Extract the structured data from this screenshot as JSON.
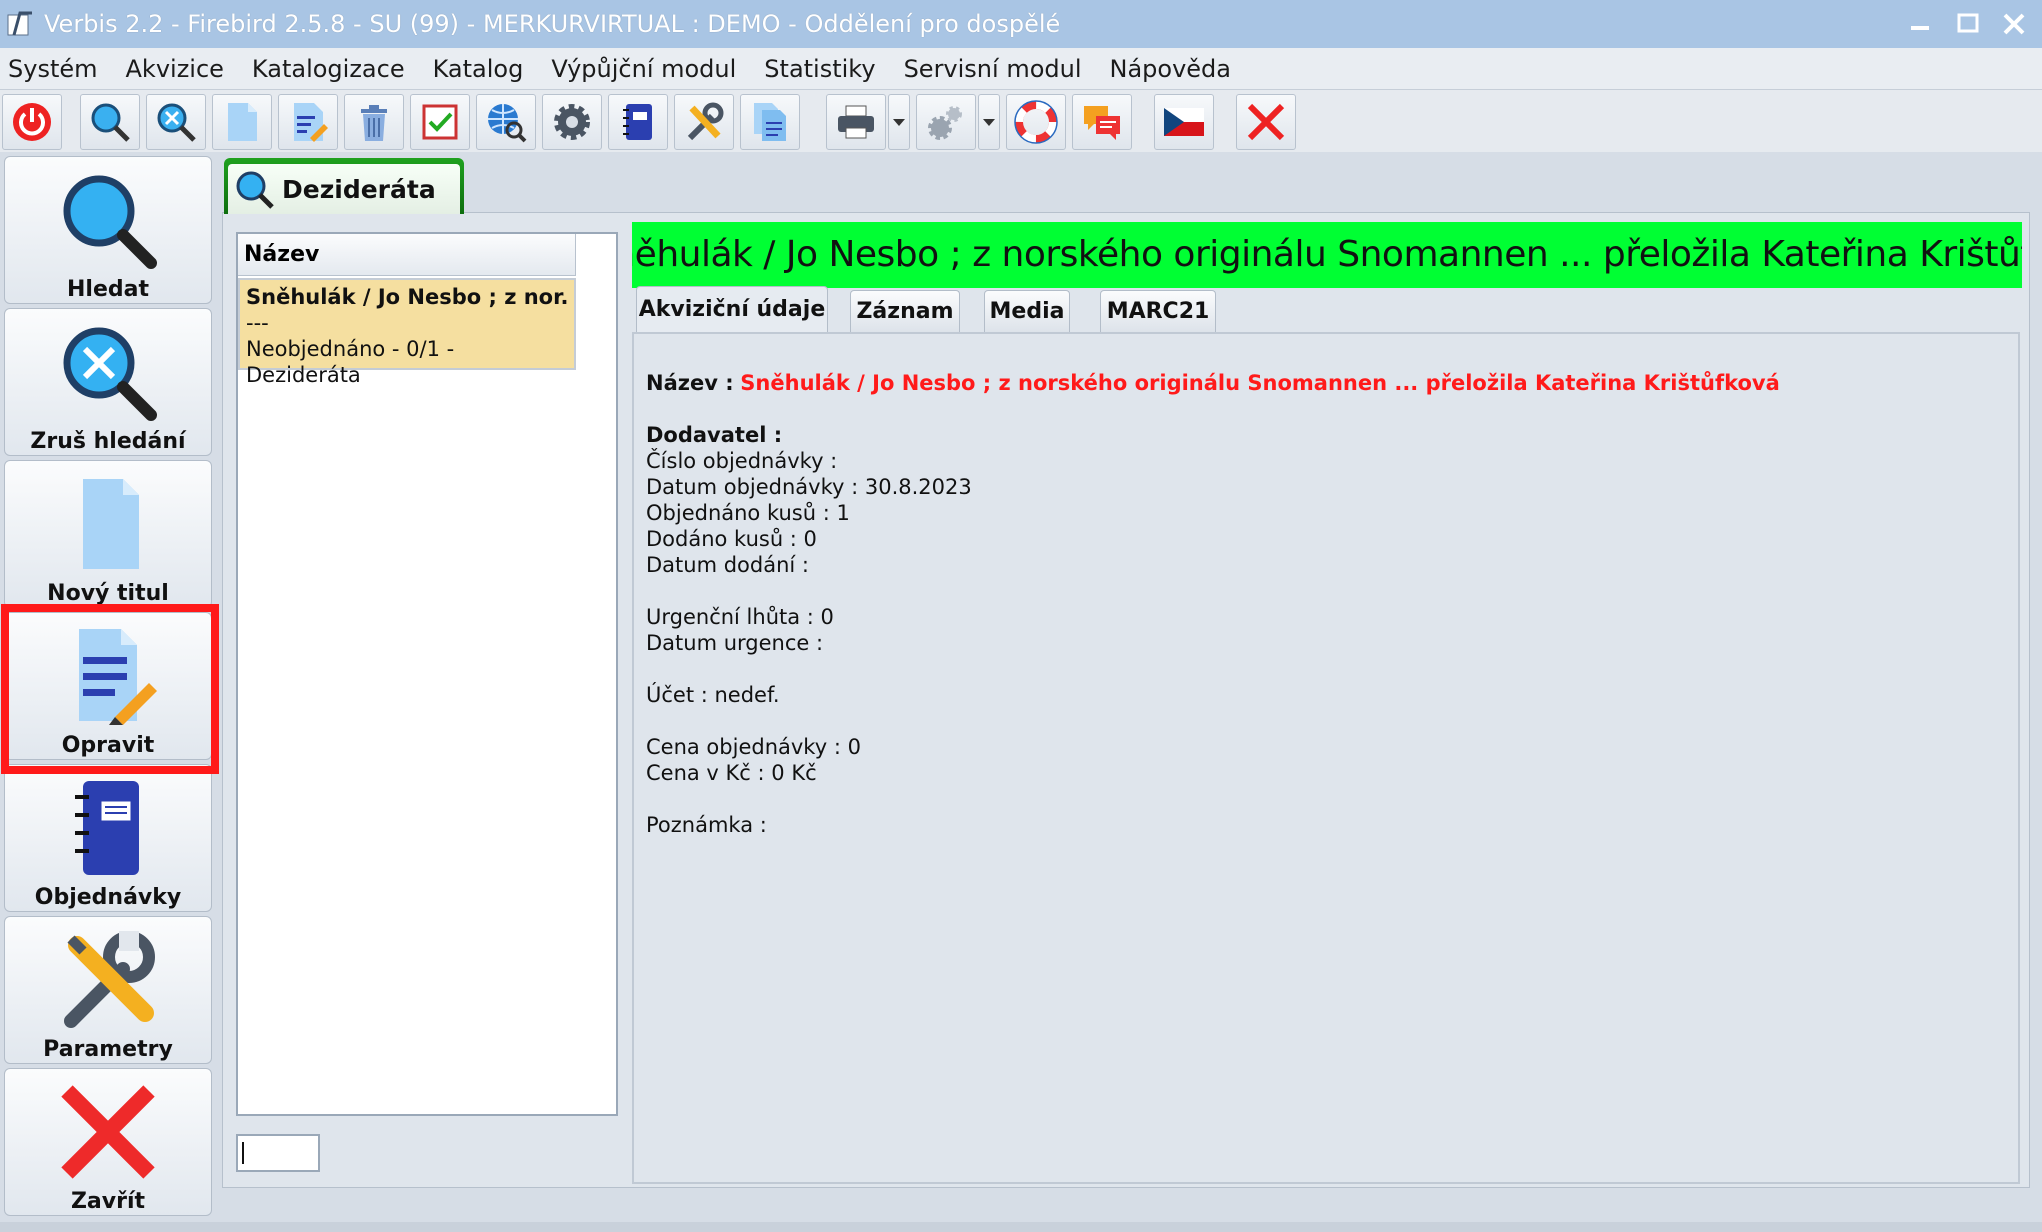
{
  "window": {
    "title": "Verbis 2.2 - Firebird 2.5.8 - SU (99) - MERKURVIRTUAL : DEMO - Oddělení pro dospělé"
  },
  "menu": [
    "Systém",
    "Akvizice",
    "Katalogizace",
    "Katalog",
    "Výpůjční modul",
    "Statistiky",
    "Servisní modul",
    "Nápověda"
  ],
  "toolbar_icons": [
    "power-icon",
    "search-icon",
    "clear-search-icon",
    "new-document-icon",
    "edit-document-icon",
    "trash-icon",
    "checkbox-icon",
    "globe-search-icon",
    "settings-gear-icon",
    "notebook-icon",
    "tools-icon",
    "documents-icon",
    "printer-icon",
    "cogs-icon",
    "lifebuoy-icon",
    "chat-icon",
    "czech-flag-icon",
    "close-icon"
  ],
  "sidebar": {
    "items": [
      {
        "label": "Hledat",
        "icon": "search-icon"
      },
      {
        "label": "Zruš hledání",
        "icon": "clear-search-icon"
      },
      {
        "label": "Nový titul",
        "icon": "new-document-icon"
      },
      {
        "label": "Opravit",
        "icon": "edit-document-icon"
      },
      {
        "label": "Objednávky",
        "icon": "notebook-icon"
      },
      {
        "label": "Parametry",
        "icon": "tools-icon"
      },
      {
        "label": "Zavřít",
        "icon": "close-icon"
      }
    ]
  },
  "module_tab": {
    "label": "Dezideráta"
  },
  "list": {
    "column_header": "Název",
    "rows": [
      {
        "line1": "Sněhulák / Jo Nesbo ; z nor...",
        "line2": "---",
        "line3": "Neobjednáno - 0/1 - Dezideráta"
      }
    ]
  },
  "detail": {
    "banner": "Sněhulák / Jo Nesbo ; z norského originálu Snomannen ... přeložila Kateřina Krištůfková",
    "tabs": [
      "Akviziční údaje",
      "Záznam",
      "Media",
      "MARC21"
    ],
    "nazev_label": "Název :",
    "nazev_value": "Sněhulák / Jo Nesbo ; z norského originálu Snomannen ... přeložila Kateřina Krištůfková",
    "dodavatel": "Dodavatel :",
    "cislo_objednavky": "Číslo objednávky :",
    "datum_objednavky": "Datum objednávky : 30.8.2023",
    "objednano_kusu": "Objednáno kusů : 1",
    "dodano_kusu": "Dodáno kusů : 0",
    "datum_dodani": "Datum dodání :",
    "urgencni_lhuta": "Urgenční lhůta : 0",
    "datum_urgence": "Datum urgence :",
    "ucet": "Účet : nedef.",
    "cena_objednavky": "Cena objednávky : 0",
    "cena_v_kc": "Cena v Kč : 0 Kč",
    "poznamka": "Poznámka :"
  },
  "colors": {
    "banner_bg": "#00ff33",
    "selected_row_bg": "#f5dfa0",
    "highlight_border": "#ff1a1a",
    "title_value": "#ff1a1a"
  }
}
